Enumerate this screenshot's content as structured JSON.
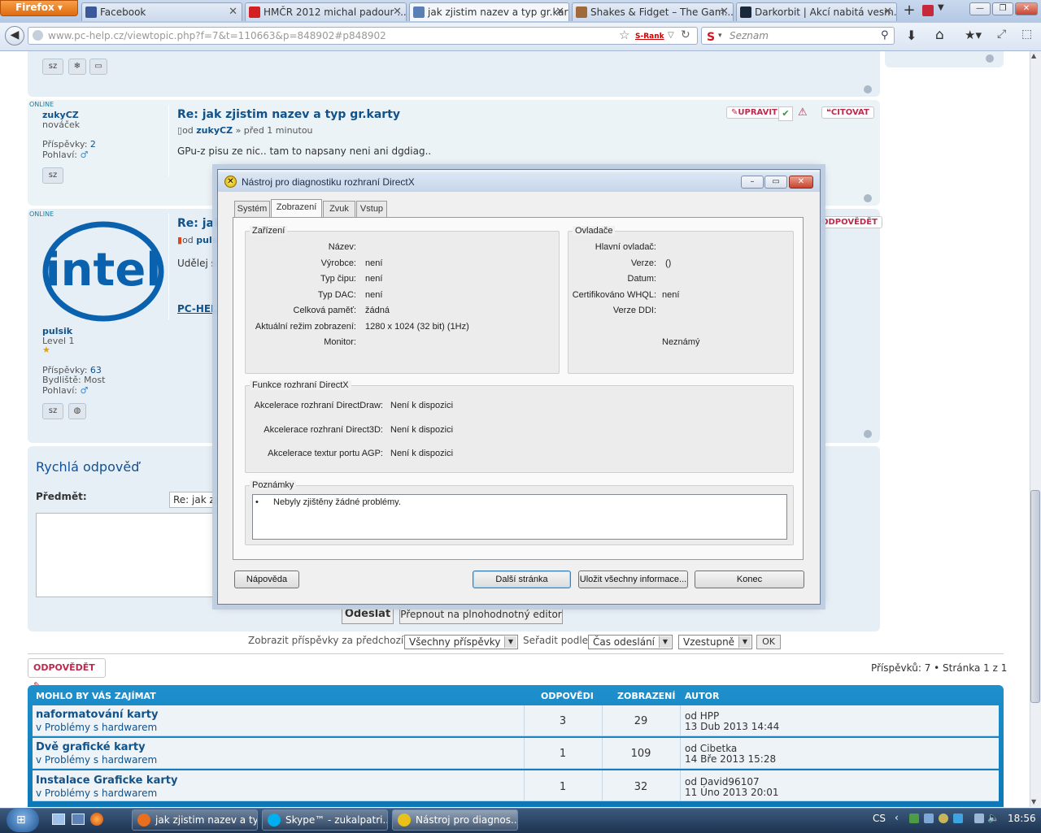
{
  "browser": {
    "firefox_label": "Firefox",
    "tabs": [
      {
        "label": "Facebook",
        "icon_color": "#3b5998"
      },
      {
        "label": "HMČR 2012 michal padour ...",
        "icon_color": "#d32020"
      },
      {
        "label": "jak zjistim nazev a typ gr.karty",
        "icon_color": "#5a7fb5"
      },
      {
        "label": "Shakes & Fidget – The Gam...",
        "icon_color": "#a06a3a"
      },
      {
        "label": "Darkorbit | Akcí nabitá vesm...",
        "icon_color": "#1b2a3a"
      }
    ],
    "url_domain": "www.pc-help.cz",
    "url_path": "/viewtopic.php?f=7&t=110663&p=848902#p848902",
    "srank": "S-Rank",
    "search_placeholder": "Seznam"
  },
  "forum": {
    "post1": {
      "status": "ONLINE",
      "user": "zukyCZ",
      "rank": "nováček",
      "posts_label": "Příspěvky:",
      "posts": "2",
      "gender_label": "Pohlaví:",
      "title": "Re: jak zjistim nazev a typ gr.karty",
      "meta_prefix": "od",
      "meta_user": "zukyCZ",
      "meta_time": "» před 1 minutou",
      "body": "GPu-z pisu ze nic.. tam to napsany neni ani dgdiag..",
      "btn_edit": "UPRAVIT",
      "btn_quote": "CITOVAT"
    },
    "post2": {
      "status": "ONLINE",
      "logo_text": "intel",
      "user": "pulsik",
      "rank": "Level 1",
      "posts_label": "Příspěvky:",
      "posts": "63",
      "location_label": "Bydliště:",
      "location": "Most",
      "gender_label": "Pohlaví:",
      "title": "Re: jak",
      "meta_prefix": "od",
      "meta_user": "puls",
      "body": "Udělej s",
      "sig": "PC-HEL",
      "btn_reply": "ODPOVĚDĚT"
    },
    "badge_sz": "sz",
    "quick_reply": {
      "title": "Rychlá odpověď",
      "subject_label": "Předmět:",
      "subject_value": "Re: jak zj",
      "send": "Odeslat",
      "full_editor": "Přepnout na plnohodnotný editor"
    },
    "filter": {
      "show_label": "Zobrazit příspěvky za předchozí:",
      "show_value": "Všechny příspěvky",
      "sort_label": "Seřadit podle",
      "sort_value": "Čas odeslání",
      "order_value": "Vzestupně",
      "ok": "OK"
    },
    "reply_button": "ODPOVĚDĚT",
    "pagination": "Příspěvků: 7 • Stránka 1 z 1",
    "topics": {
      "headers": [
        "MOHLO BY VÁS ZAJÍMAT",
        "ODPOVĚDI",
        "ZOBRAZENÍ",
        "AUTOR"
      ],
      "rows": [
        {
          "title": "naformatování karty",
          "forum": "v Problémy s hardwarem",
          "replies": "3",
          "views": "29",
          "author": "od HPP",
          "date": "13 Dub 2013 14:44"
        },
        {
          "title": "Dvě grafické karty",
          "forum": "v Problémy s hardwarem",
          "replies": "1",
          "views": "109",
          "author": "od Cibetka",
          "date": "14 Bře 2013 15:28"
        },
        {
          "title": "Instalace Graficke karty",
          "forum": "v Problémy s hardwarem",
          "replies": "1",
          "views": "32",
          "author": "od David96107",
          "date": "11 Úno 2013 20:01"
        }
      ]
    }
  },
  "dialog": {
    "title": "Nástroj pro diagnostiku rozhraní DirectX",
    "tabs": [
      "Systém",
      "Zobrazení",
      "Zvuk",
      "Vstup"
    ],
    "device_group": "Zařízení",
    "device": [
      {
        "label": "Název:",
        "value": ""
      },
      {
        "label": "Výrobce:",
        "value": "není"
      },
      {
        "label": "Typ čipu:",
        "value": "není"
      },
      {
        "label": "Typ DAC:",
        "value": "není"
      },
      {
        "label": "Celková paměť:",
        "value": "žádná"
      },
      {
        "label": "Aktuální režim zobrazení:",
        "value": "1280 x 1024 (32 bit) (1Hz)"
      },
      {
        "label": "Monitor:",
        "value": ""
      }
    ],
    "drivers_group": "Ovladače",
    "drivers": [
      {
        "label": "Hlavní ovladač:",
        "value": ""
      },
      {
        "label": "Verze:",
        "value": "()"
      },
      {
        "label": "Datum:",
        "value": ""
      },
      {
        "label": "Certifikováno WHQL:",
        "value": "není"
      },
      {
        "label": "Verze DDI:",
        "value": ""
      }
    ],
    "drivers_unknown": "Neznámý",
    "features_group": "Funkce rozhraní DirectX",
    "features": [
      {
        "label": "Akcelerace rozhraní DirectDraw:",
        "value": "Není k dispozici"
      },
      {
        "label": "Akcelerace rozhraní Direct3D:",
        "value": "Není k dispozici"
      },
      {
        "label": "Akcelerace textur portu AGP:",
        "value": "Není k dispozici"
      }
    ],
    "notes_group": "Poznámky",
    "notes": "Nebyly zjištěny žádné problémy.",
    "buttons": {
      "help": "Nápověda",
      "next": "Další stránka",
      "save": "Uložit všechny informace...",
      "exit": "Konec"
    }
  },
  "taskbar": {
    "items": [
      {
        "label": "jak zjistim nazev a ty...",
        "icon_color": "#e76f1e"
      },
      {
        "label": "Skype™ - zukalpatri...",
        "icon_color": "#00aff0"
      },
      {
        "label": "Nástroj pro diagnos...",
        "icon_color": "#e8c21a"
      }
    ],
    "lang": "CS",
    "clock": "18:56"
  }
}
